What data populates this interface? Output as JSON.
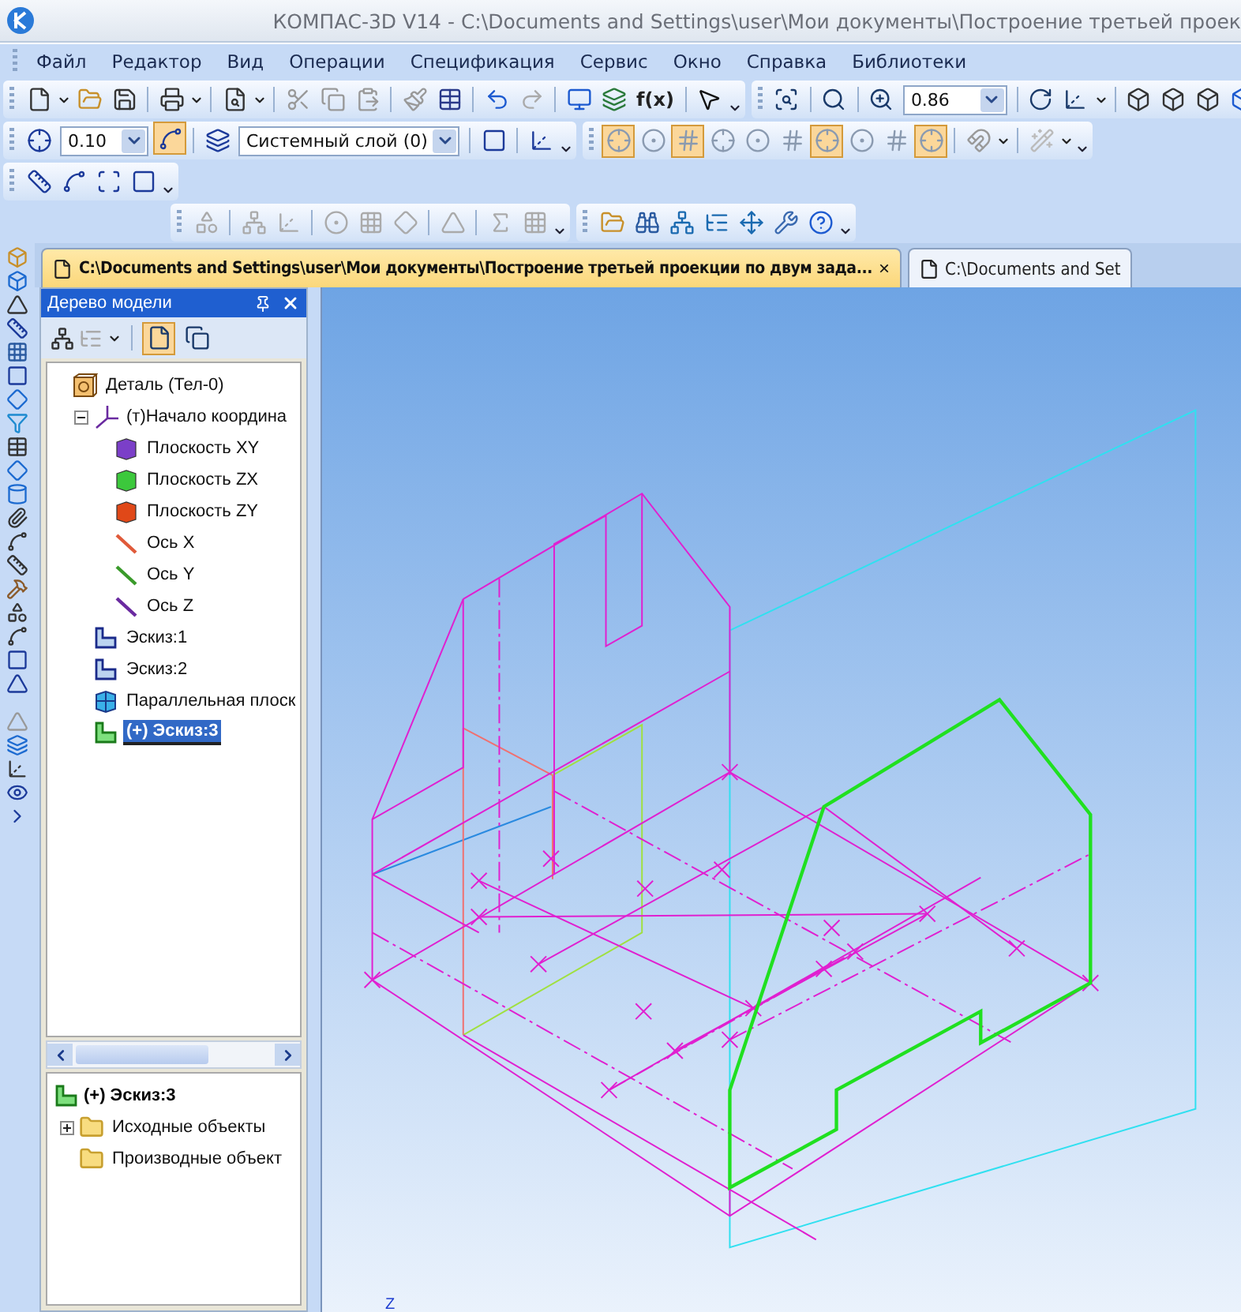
{
  "window": {
    "title": "КОМПАС-3D V14 - C:\\Documents and Settings\\user\\Мои документы\\Построение третьей проек"
  },
  "menu": [
    "Файл",
    "Редактор",
    "Вид",
    "Операции",
    "Спецификация",
    "Сервис",
    "Окно",
    "Справка",
    "Библиотеки"
  ],
  "toolbar": {
    "fx_label": "f(x)",
    "scale": "0.86",
    "step": "0.10",
    "snap_toggle": {
      "pressed": true
    },
    "layer": "Системный слой (0)",
    "snaps": [
      {
        "pressed": true
      },
      {
        "pressed": false
      },
      {
        "pressed": true
      },
      {
        "pressed": false
      },
      {
        "pressed": false
      },
      {
        "pressed": false
      },
      {
        "pressed": true
      },
      {
        "pressed": false
      },
      {
        "pressed": false
      },
      {
        "pressed": true
      }
    ]
  },
  "tabs": [
    {
      "label": "C:\\Documents and Settings\\user\\Мои документы\\Построение третьей проекции по двум зада...",
      "selected": true,
      "close": "×"
    },
    {
      "label": "C:\\Documents and Set",
      "selected": false
    }
  ],
  "tree_panel": {
    "title": "Дерево модели",
    "view_buttons": [
      {
        "selected": true
      },
      {
        "selected": false
      }
    ],
    "tree": [
      {
        "label": "Деталь (Тел-0)",
        "kind": "part",
        "selected": false,
        "children": [
          {
            "label": "(т)Начало координа",
            "kind": "origin",
            "selected": false,
            "expanded": true,
            "children": [
              {
                "label": "Плоскость XY",
                "kind": "plane",
                "color": "#7b3fc8",
                "selected": false
              },
              {
                "label": "Плоскость ZX",
                "kind": "plane",
                "color": "#3cc83c",
                "selected": false
              },
              {
                "label": "Плоскость ZY",
                "kind": "plane",
                "color": "#e04818",
                "selected": false
              },
              {
                "label": "Ось X",
                "kind": "axis",
                "color": "#e05a3a",
                "selected": false
              },
              {
                "label": "Ось Y",
                "kind": "axis",
                "color": "#3a9a2a",
                "selected": false
              },
              {
                "label": "Ось Z",
                "kind": "axis",
                "color": "#6a2aa0",
                "selected": false
              }
            ]
          },
          {
            "label": "Эскиз:1",
            "kind": "sketch",
            "selected": false
          },
          {
            "label": "Эскиз:2",
            "kind": "sketch",
            "selected": false
          },
          {
            "label": "Параллельная плоск",
            "kind": "parallel-plane",
            "selected": false
          },
          {
            "label": "(+) Эскиз:3",
            "kind": "active-sketch",
            "selected": true
          }
        ]
      }
    ]
  },
  "sketch_tree": {
    "title": "(+) Эскиз:3",
    "items": [
      {
        "label": "Исходные объекты",
        "expanded": false
      },
      {
        "label": "Производные объект"
      }
    ]
  },
  "viewport": {
    "axis_label": "Z"
  }
}
